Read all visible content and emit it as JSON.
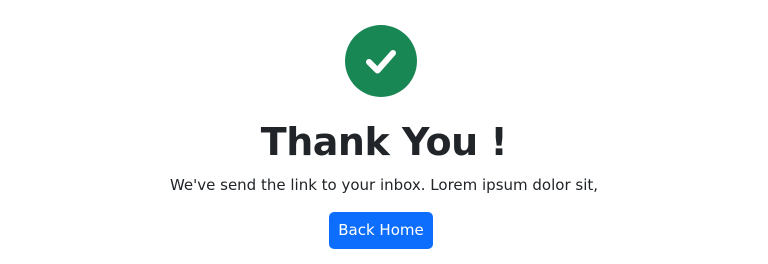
{
  "icon": {
    "name": "check-icon",
    "circle_color": "#198754",
    "check_color": "#ffffff"
  },
  "heading": {
    "title": "Thank You !"
  },
  "message": {
    "text": "We've send the link to your inbox. Lorem ipsum dolor sit,"
  },
  "actions": {
    "back_home_label": "Back Home",
    "button_color": "#0d6efd"
  }
}
